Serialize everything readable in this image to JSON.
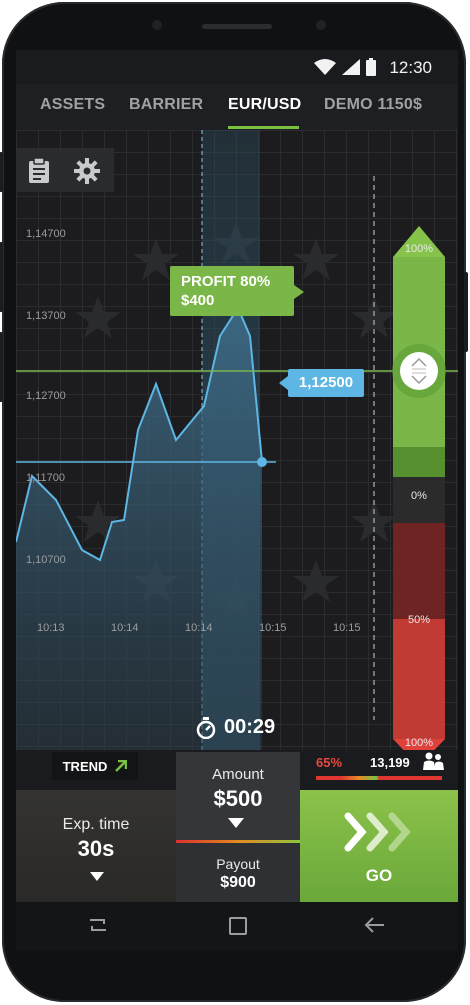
{
  "status_bar": {
    "time": "12:30"
  },
  "tabs": [
    {
      "label": "ASSETS",
      "active": false
    },
    {
      "label": "BARRIER",
      "active": false
    },
    {
      "label": "EUR/USD",
      "active": true
    },
    {
      "label": "DEMO 1150$",
      "active": false
    }
  ],
  "chart": {
    "y_labels": [
      "1,14700",
      "1,13700",
      "1,12700",
      "1,11700",
      "1,10700"
    ],
    "x_labels": [
      "10:13",
      "10:14",
      "10:14",
      "10:15",
      "10:15"
    ],
    "profit": {
      "label": "PROFIT 80%",
      "amount": "$400"
    },
    "current_price": "1,12500",
    "scale": {
      "top": "100%",
      "middle": "0%",
      "lower": "50%",
      "bottom": "100%"
    },
    "timer": "00:29",
    "colors": {
      "line": "#5db6e4",
      "profit": "#7ab648",
      "loss": "#d9312d"
    }
  },
  "trend": {
    "label": "TREND"
  },
  "amount": {
    "label": "Amount",
    "value": "$500"
  },
  "payout": {
    "label": "Payout",
    "value": "$900"
  },
  "sentiment": {
    "percent": "65%",
    "traders": "13,199"
  },
  "expiration": {
    "label": "Exp. time",
    "value": "30s"
  },
  "go_button": {
    "label": "GO"
  }
}
